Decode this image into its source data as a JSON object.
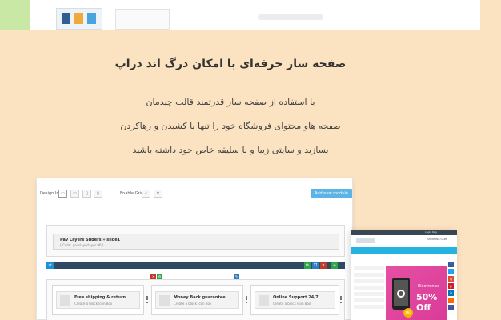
{
  "heading": "صفحه ساز حرفه‌ای با امکان درگ اند دراپ",
  "description": [
    "با استفاده از صفحه ساز قدرتمند قالب چیدمان",
    "صفحه هاو محتوای فروشگاه خود را تنها با کشیدن و رهاکردن",
    "بسازید و سایتی زیبا و با سلیقه خاص خود داشته باشید"
  ],
  "builder": {
    "design_in_label": "Design In",
    "enable_grid_label": "Enable Grid",
    "add_module_label": "Add new module",
    "device_icons": [
      "desktop-icon",
      "laptop-icon",
      "tablet-icon",
      "mobile-icon"
    ],
    "slider": {
      "title": "Pav Layers Sliders » slide1",
      "code": "( Code: pavslayerlayer 96 )"
    },
    "blocks": [
      {
        "title": "Free shipping & return",
        "subtitle": "Create a block Icon Box"
      },
      {
        "title": "Money Back guarantee",
        "subtitle": "Create a block Icon Box"
      },
      {
        "title": "Online Support 24/7",
        "subtitle": "Create a block Icon Box"
      }
    ]
  },
  "shop": {
    "banner_category": "Electronics",
    "banner_offer": "50% Off",
    "badge": "$60",
    "cart_label": "SHOPPING CART",
    "top_links": "Login  Reg"
  },
  "colors": {
    "background": "#fbe3c2",
    "accent_blue": "#5bb3e6",
    "divider_dark": "#2f4b64",
    "banner_pink": "#e64fa3"
  }
}
